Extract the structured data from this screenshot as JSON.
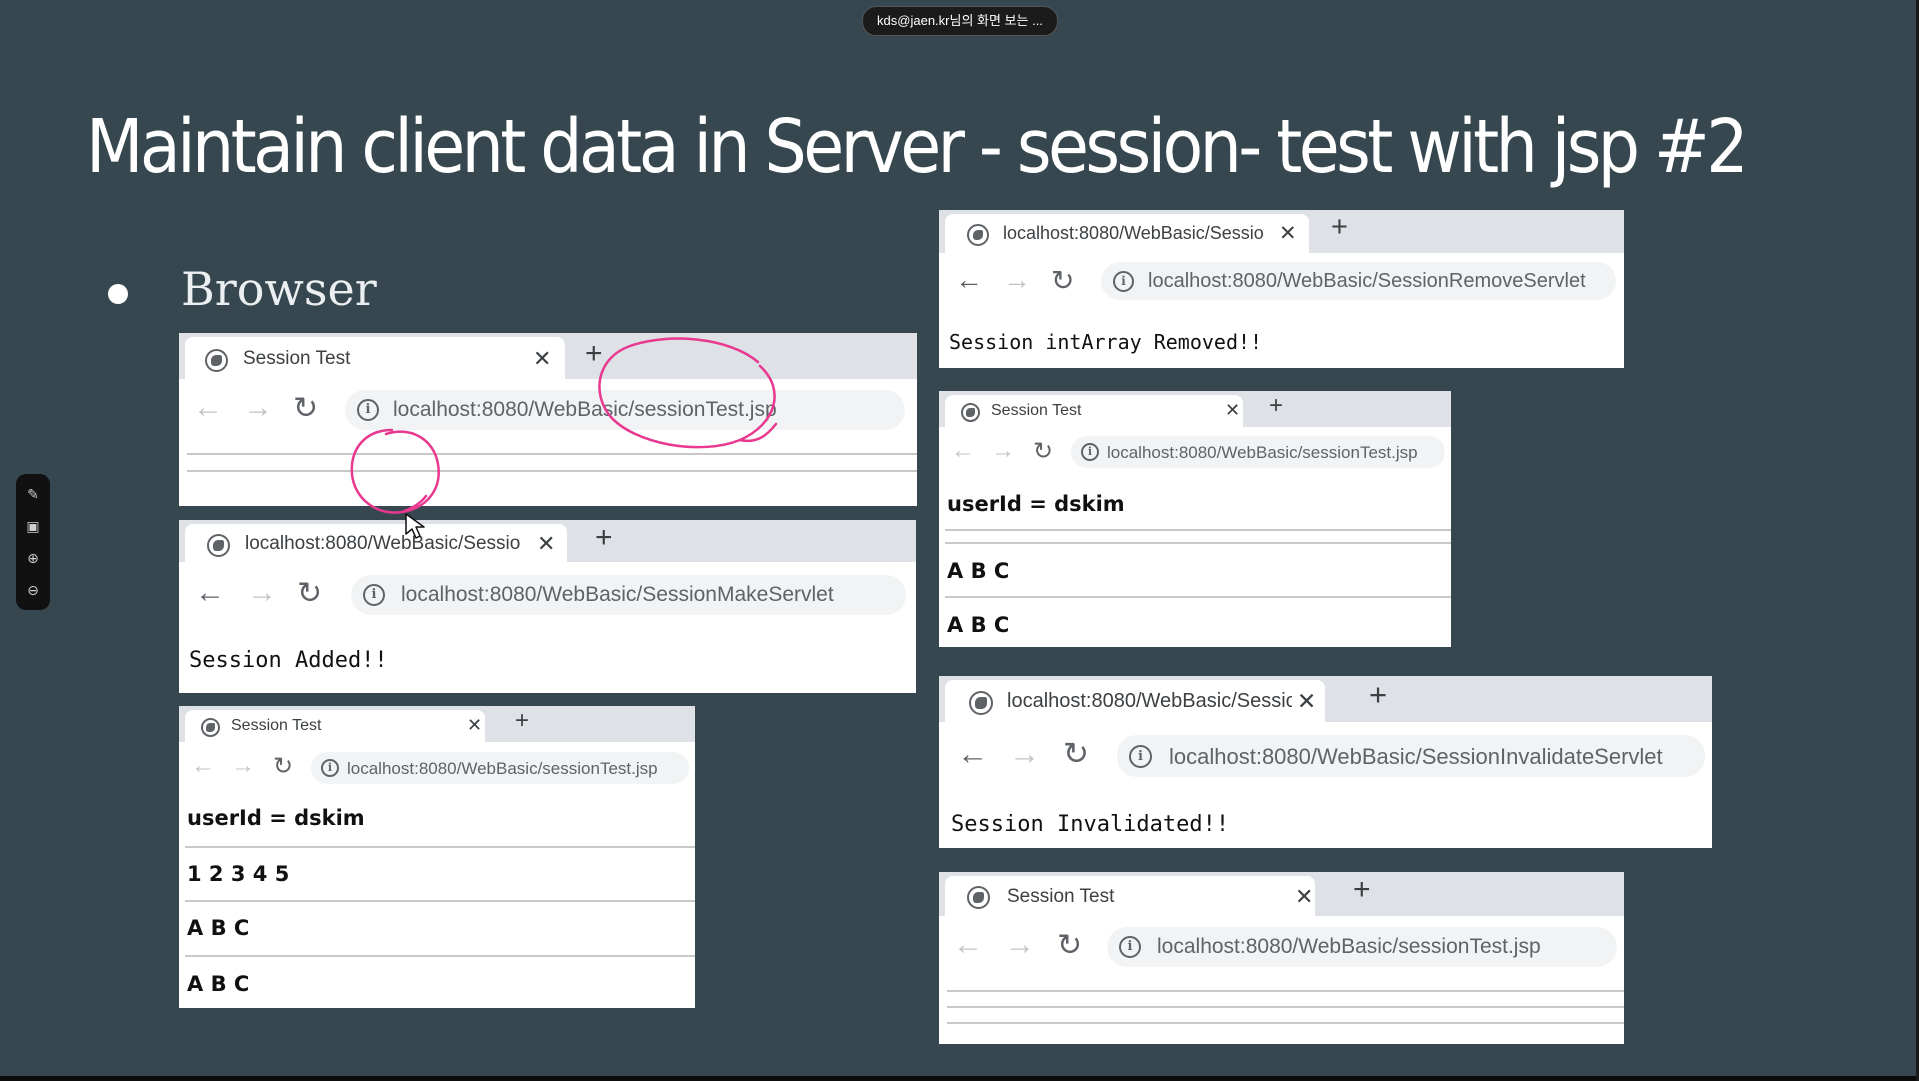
{
  "share_banner": {
    "text": "kds@jaen.kr님의 화면 보는 ..."
  },
  "slide": {
    "title": "Maintain client data in Server - session- test with jsp #2",
    "bullet": "Browser",
    "accent": "#37474f",
    "annotation_color": "#e8388f"
  },
  "toolbar": {
    "icons": [
      "pen-icon",
      "screen-share-icon",
      "zoom-in-icon",
      "zoom-out-icon"
    ]
  },
  "windows": {
    "w1": {
      "tab_title": "Session Test",
      "url": "localhost:8080/WebBasic/sessionTest.jsp"
    },
    "w2": {
      "tab_title": "localhost:8080/WebBasic/Sessio",
      "url": "localhost:8080/WebBasic/SessionMakeServlet",
      "content": "Session Added!!"
    },
    "w3": {
      "tab_title": "Session Test",
      "url": "localhost:8080/WebBasic/sessionTest.jsp",
      "rows": [
        "userId = dskim",
        "1 2 3 4 5",
        "A B C",
        "A B C"
      ]
    },
    "w4": {
      "tab_title": "localhost:8080/WebBasic/Sessio",
      "url": "localhost:8080/WebBasic/SessionRemoveServlet",
      "content": "Session intArray Removed!!"
    },
    "w5": {
      "tab_title": "Session Test",
      "url": "localhost:8080/WebBasic/sessionTest.jsp",
      "rows": [
        "userId = dskim",
        "A B C",
        "A B C"
      ]
    },
    "w6": {
      "tab_title": "localhost:8080/WebBasic/Sessio",
      "url": "localhost:8080/WebBasic/SessionInvalidateServlet",
      "content": "Session Invalidated!!"
    },
    "w7": {
      "tab_title": "Session Test",
      "url": "localhost:8080/WebBasic/sessionTest.jsp"
    }
  }
}
